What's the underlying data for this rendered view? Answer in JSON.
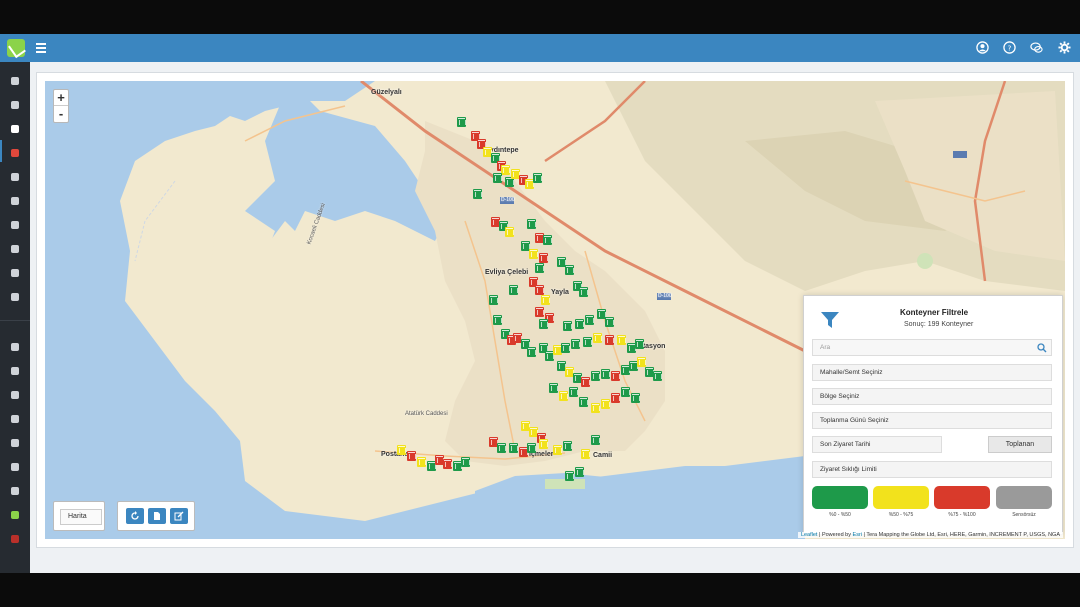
{
  "header": {
    "icons": [
      "user-icon",
      "help-icon",
      "chat-icon",
      "settings-icon"
    ]
  },
  "sidebar": {
    "items": [
      "dashboard-icon",
      "sitemap-icon",
      "trash-icon",
      "bell-icon",
      "list-icon",
      "monitor-icon",
      "database-icon",
      "square-icon",
      "users-icon",
      "document-icon",
      "user-circle-icon",
      "sliders-icon",
      "eye-icon",
      "gauge-icon",
      "battery-icon",
      "cogs-icon",
      "chart-icon",
      "logo-icon",
      "power-icon"
    ]
  },
  "map": {
    "zoom_in": "+",
    "zoom_out": "-",
    "labels": {
      "guzelyali": "Güzelyalı",
      "aydintepe": "Aydıntepe",
      "evliya": "Evliya Çelebi",
      "yayla": "Yayla",
      "istasyon": "İstasyon",
      "postane": "Postane",
      "icmeler": "İçmeler",
      "camii": "Camii",
      "road_d100": "D-100",
      "road_d100b": "D-100",
      "kocaeli_cad": "Kocaeli Caddesi",
      "ataturk_cad": "Atatürk Caddesi"
    },
    "layer_button": "Harita",
    "attribution_leaflet": "Leaflet",
    "attribution_esri": "Esri",
    "attribution_powered": "| Powered by",
    "attribution_rest": "| Tera Mapping the Globe Ltd, Esri, HERE, Garmin, INCREMENT P, USGS, NGA"
  },
  "filter": {
    "title": "Konteyner Filtrele",
    "result": "Sonuç: 199 Konteyner",
    "search_placeholder": "Ara",
    "mahalle": "Mahalle/Semt Seçiniz",
    "bolge": "Bölge Seçiniz",
    "toplanma": "Toplanma Günü Seçiniz",
    "son_ziyaret": "Son Ziyaret Tarihi",
    "toplanan": "Toplanan",
    "ziyaret_siklik": "Ziyaret Sıklığı Limiti",
    "legend": [
      {
        "label": "%0 - %50",
        "color": "#1e9a4a"
      },
      {
        "label": "%50 - %75",
        "color": "#f2e21c"
      },
      {
        "label": "%75 - %100",
        "color": "#d93a2b"
      },
      {
        "label": "Sensörsüz",
        "color": "#9a9a9a"
      }
    ]
  },
  "colors": {
    "green": "#1e9a4a",
    "yellow": "#f2e21c",
    "red": "#d93a2b",
    "gray": "#9a9a9a",
    "water": "#aacbe9",
    "land": "#f2e9cf",
    "header": "#3b86c0"
  }
}
